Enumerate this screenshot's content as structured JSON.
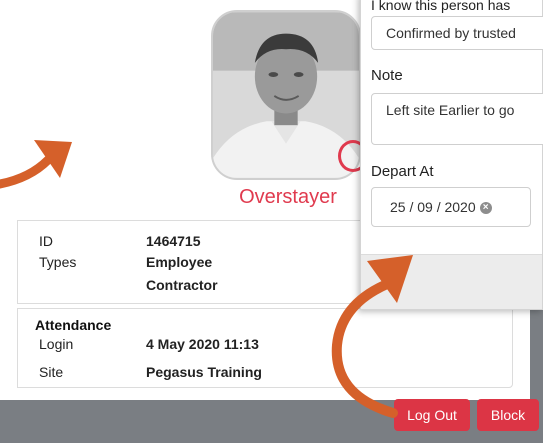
{
  "person": {
    "status": "Overstayer",
    "id_label": "ID",
    "id_value": "1464715",
    "types_label": "Types",
    "types": [
      "Employee",
      "Contractor"
    ]
  },
  "attendance": {
    "title": "Attendance",
    "login_label": "Login",
    "login_value": "4 May 2020 11:13",
    "site_label": "Site",
    "site_value": "Pegasus Training"
  },
  "actions": {
    "logout_label": "Log Out",
    "block_label": "Block"
  },
  "depart_dialog": {
    "reason_label": "I know this person has",
    "reason_value": "Confirmed by trusted",
    "note_label": "Note",
    "note_value": "Left site Earlier to go",
    "depart_label": "Depart At",
    "depart_value": "25 / 09 / 2020"
  },
  "colors": {
    "danger": "#dc3545",
    "status": "#e03a4e",
    "arrow": "#d5602a"
  }
}
